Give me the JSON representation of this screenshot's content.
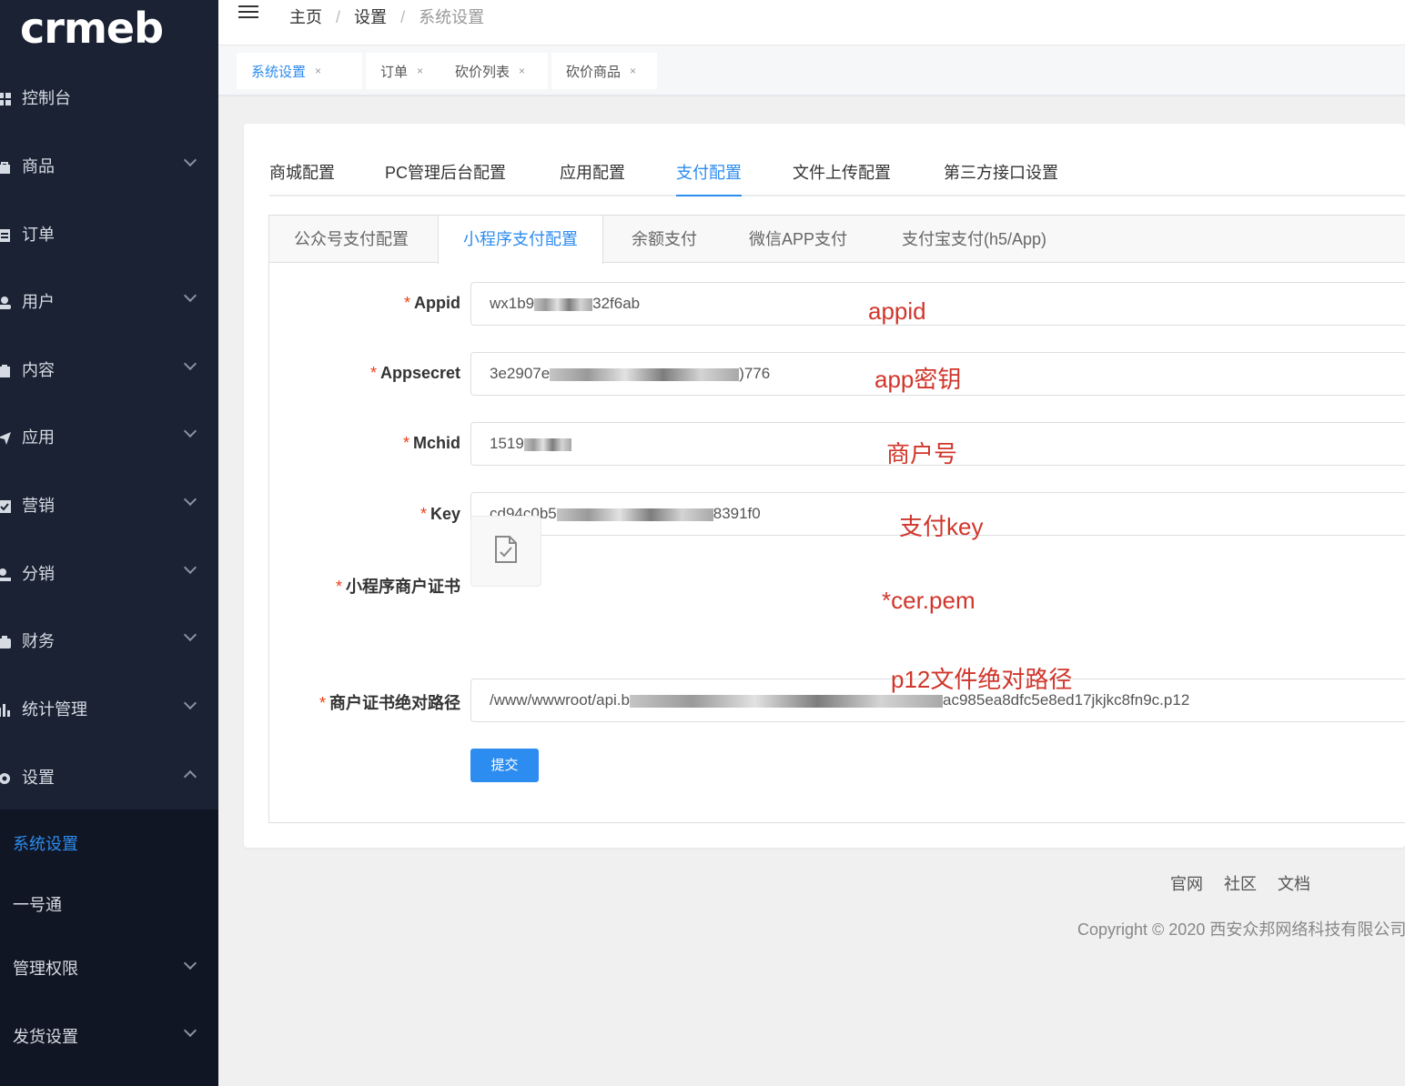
{
  "brand": {
    "logo_text": "crmeb"
  },
  "sidebar": {
    "items": [
      {
        "label": "控制台",
        "icon": "dashboard-icon",
        "chevron": false
      },
      {
        "label": "商品",
        "icon": "bag-icon",
        "chevron": true
      },
      {
        "label": "订单",
        "icon": "order-icon",
        "chevron": true
      },
      {
        "label": "用户",
        "icon": "user-icon",
        "chevron": true
      },
      {
        "label": "内容",
        "icon": "content-icon",
        "chevron": true
      },
      {
        "label": "应用",
        "icon": "app-icon",
        "chevron": true
      },
      {
        "label": "营销",
        "icon": "marketing-icon",
        "chevron": true
      },
      {
        "label": "分销",
        "icon": "distribution-icon",
        "chevron": true
      },
      {
        "label": "财务",
        "icon": "finance-icon",
        "chevron": true
      },
      {
        "label": "统计管理",
        "icon": "stats-icon",
        "chevron": true
      },
      {
        "label": "设置",
        "icon": "gear-icon",
        "chevron": true,
        "expanded": true
      }
    ],
    "subitems": [
      {
        "label": "系统设置",
        "active": true
      },
      {
        "label": "一号通"
      },
      {
        "label": "管理权限",
        "chevron": true
      },
      {
        "label": "发货设置",
        "chevron": true
      }
    ]
  },
  "breadcrumb": {
    "home": "主页",
    "sep": "/",
    "level2": "设置",
    "current": "系统设置"
  },
  "tags": [
    {
      "label": "系统设置",
      "active": true,
      "close": "×"
    },
    {
      "label": "订单",
      "close": "×"
    },
    {
      "label": "砍价列表",
      "close": "×"
    },
    {
      "label": "砍价商品",
      "close": "×"
    }
  ],
  "main_tabs": [
    "商城配置",
    "PC管理后台配置",
    "应用配置",
    "支付配置",
    "文件上传配置",
    "第三方接口设置"
  ],
  "main_tab_active": "支付配置",
  "sub_tabs": [
    "公众号支付配置",
    "小程序支付配置",
    "余额支付",
    "微信APP支付",
    "支付宝支付(h5/App)"
  ],
  "sub_tab_active": "小程序支付配置",
  "form": {
    "required_mark": "*",
    "appid": {
      "label": "Appid",
      "value_prefix": "wx1b9",
      "value_suffix": "32f6ab"
    },
    "appsecret": {
      "label": "Appsecret",
      "value_prefix": "3e2907e",
      "value_suffix": ")776"
    },
    "mchid": {
      "label": "Mchid",
      "value_prefix": "1519",
      "value_suffix": ""
    },
    "key": {
      "label": "Key",
      "value_prefix": "cd94c0b5",
      "value_suffix": "8391f0"
    },
    "cert": {
      "label": "小程序商户证书"
    },
    "cert_path": {
      "label": "商户证书绝对路径",
      "value_prefix": "/www/wwwroot/api.b",
      "value_suffix": "ac985ea8dfc5e8ed17jkjkc8fn9c.p12"
    },
    "submit": "提交"
  },
  "annotations": {
    "appid": "appid",
    "appsecret": "app密钥",
    "mchid": "商户号",
    "key": "支付key",
    "cert": "*cer.pem",
    "cert_path": "p12文件绝对路径"
  },
  "footer": {
    "links": [
      "官网",
      "社区",
      "文档"
    ],
    "copyright": "Copyright © 2020 西安众邦网络科技有限公司"
  },
  "colors": {
    "sidebar_bg": "#1a2233",
    "accent": "#2d8cf0",
    "annotation": "#d0362b",
    "required": "#ed4014"
  }
}
